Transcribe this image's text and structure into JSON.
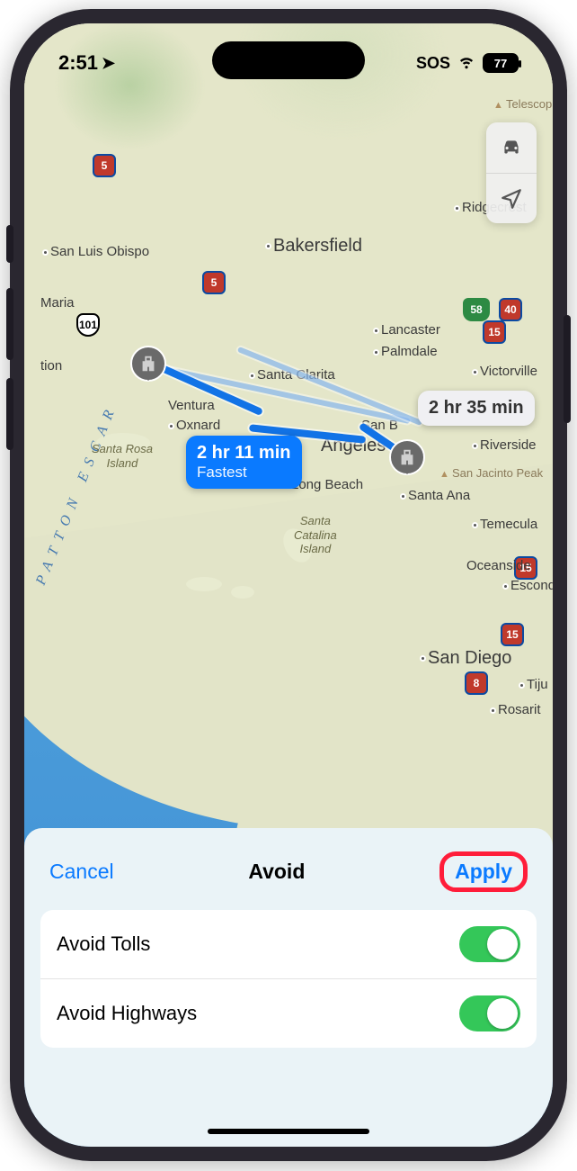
{
  "status": {
    "time": "2:51",
    "sos": "SOS",
    "battery": "77"
  },
  "map": {
    "oceanText": "PATTON ESCAR",
    "cities": {
      "bakersfield": "Bakersfield",
      "sanLuisObispo": "San Luis Obispo",
      "santaMaria": "Maria",
      "lancaster": "Lancaster",
      "palmdale": "Palmdale",
      "santaClarita": "Santa Clarita",
      "victorville": "Victorville",
      "sanBernardino": "San B",
      "ventura": "Ventura",
      "oxnard": "Oxnard",
      "losAngeles": "Angeles",
      "longBeach": "Long Beach",
      "riverside": "Riverside",
      "santaAna": "Santa Ana",
      "temecula": "Temecula",
      "oceanside": "Oceanside",
      "escondido": "Escondi",
      "sanDiego": "San Diego",
      "tijuana": "Tiju",
      "rosarito": "Rosarit",
      "ridgecrest": "Ridgecrest",
      "telescop": "Telescop",
      "tion": "tion"
    },
    "islands": {
      "santaRosa": "Santa Rosa\nIsland",
      "catalina": "Santa\nCatalina\nIsland"
    },
    "peaks": {
      "sanJacinto": "San Jacinto Peak"
    },
    "highways": {
      "i5a": "5",
      "i5b": "5",
      "us101": "101",
      "ca58": "58",
      "i40": "40",
      "i15a": "15",
      "i15b": "15",
      "i15c": "15",
      "i8": "8"
    },
    "routes": {
      "primary": {
        "time": "2 hr 11 min",
        "sub": "Fastest"
      },
      "alt": {
        "time": "2 hr 35 min"
      }
    }
  },
  "sheet": {
    "cancel": "Cancel",
    "title": "Avoid",
    "apply": "Apply",
    "options": [
      {
        "label": "Avoid Tolls",
        "on": true
      },
      {
        "label": "Avoid Highways",
        "on": true
      }
    ]
  }
}
